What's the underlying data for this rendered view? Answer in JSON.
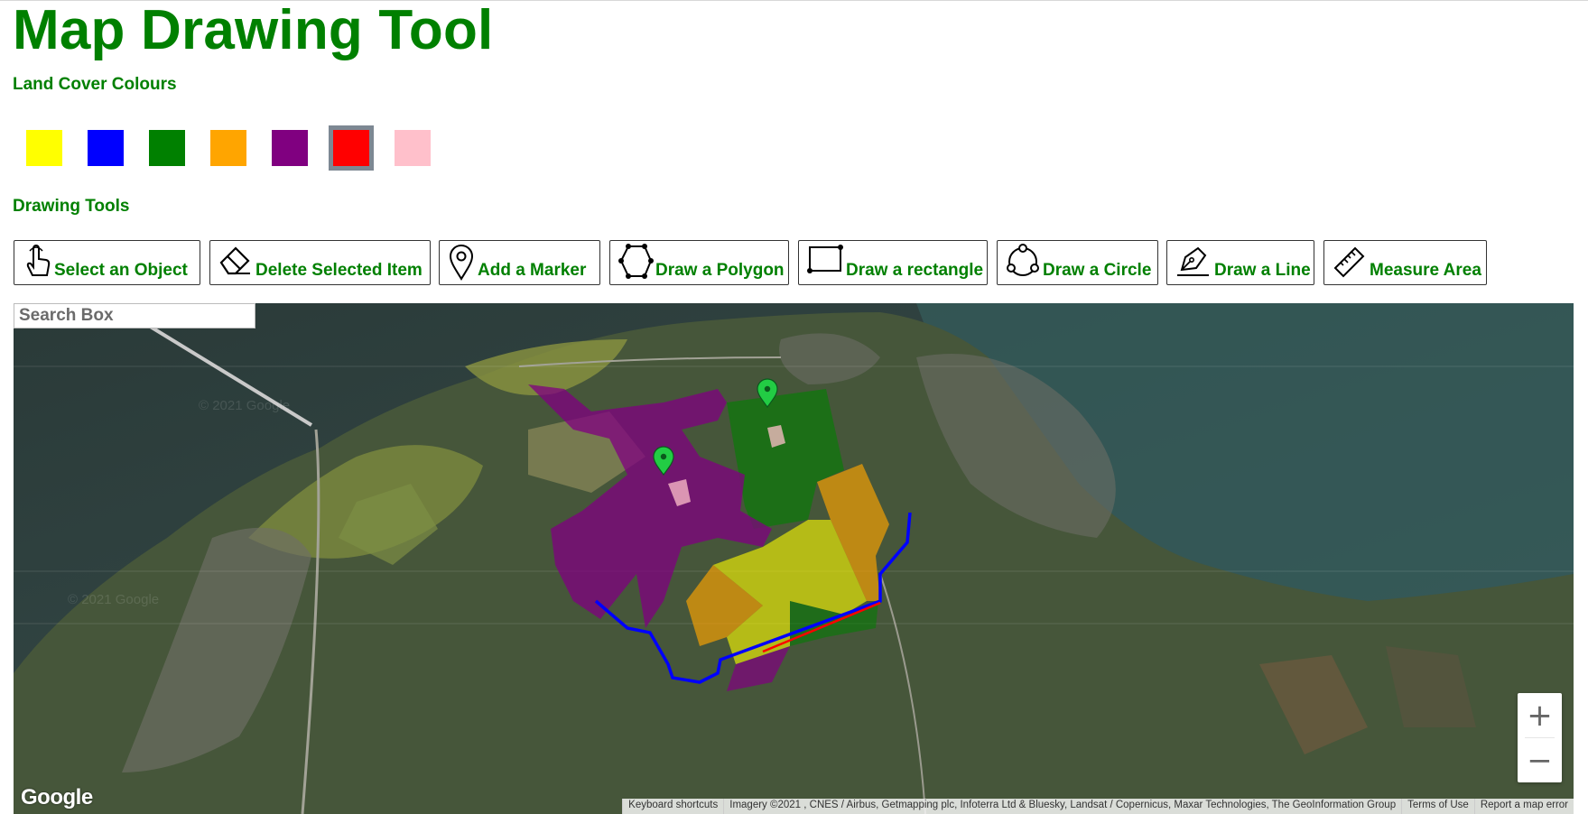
{
  "title": "Map Drawing Tool",
  "land_cover": {
    "label": "Land Cover Colours",
    "swatches": [
      {
        "name": "yellow",
        "color": "#ffff00",
        "selected": false
      },
      {
        "name": "blue",
        "color": "#0000ff",
        "selected": false
      },
      {
        "name": "green",
        "color": "#008000",
        "selected": false
      },
      {
        "name": "orange",
        "color": "#ffa500",
        "selected": false
      },
      {
        "name": "purple",
        "color": "#800080",
        "selected": false
      },
      {
        "name": "red",
        "color": "#ff0000",
        "selected": true
      },
      {
        "name": "pink",
        "color": "#ffc0cb",
        "selected": false
      }
    ]
  },
  "drawing_tools": {
    "label": "Drawing Tools",
    "buttons": [
      {
        "label": "Select an Object",
        "icon": "pointer-hand-icon"
      },
      {
        "label": "Delete Selected Item",
        "icon": "eraser-icon"
      },
      {
        "label": "Add a Marker",
        "icon": "map-pin-icon"
      },
      {
        "label": "Draw a Polygon",
        "icon": "polygon-icon"
      },
      {
        "label": "Draw a rectangle",
        "icon": "rectangle-icon"
      },
      {
        "label": "Draw a Circle",
        "icon": "circle-icon"
      },
      {
        "label": "Draw a Line",
        "icon": "pen-icon"
      },
      {
        "label": "Measure Area",
        "icon": "ruler-icon"
      }
    ]
  },
  "map": {
    "search": {
      "placeholder": "Search Box",
      "value": ""
    },
    "zoom_in": "+",
    "zoom_out": "−",
    "logo": "Google",
    "watermark": "© 2021 Google",
    "attribution": {
      "keyboard": "Keyboard shortcuts",
      "imagery": "Imagery ©2021 , CNES / Airbus, Getmapping plc, Infoterra Ltd & Bluesky, Landsat / Copernicus, Maxar Technologies, The GeoInformation Group",
      "terms": "Terms of Use",
      "report": "Report a map error"
    },
    "overlay_colors": {
      "purple": "#800080",
      "green": "#008000",
      "orange": "#ffa500",
      "yellow": "#ffff00",
      "pink": "#ffc0cb",
      "blue": "#0000ff",
      "red": "#ff0000",
      "marker": "#22cc44"
    },
    "marker_count": 2
  }
}
